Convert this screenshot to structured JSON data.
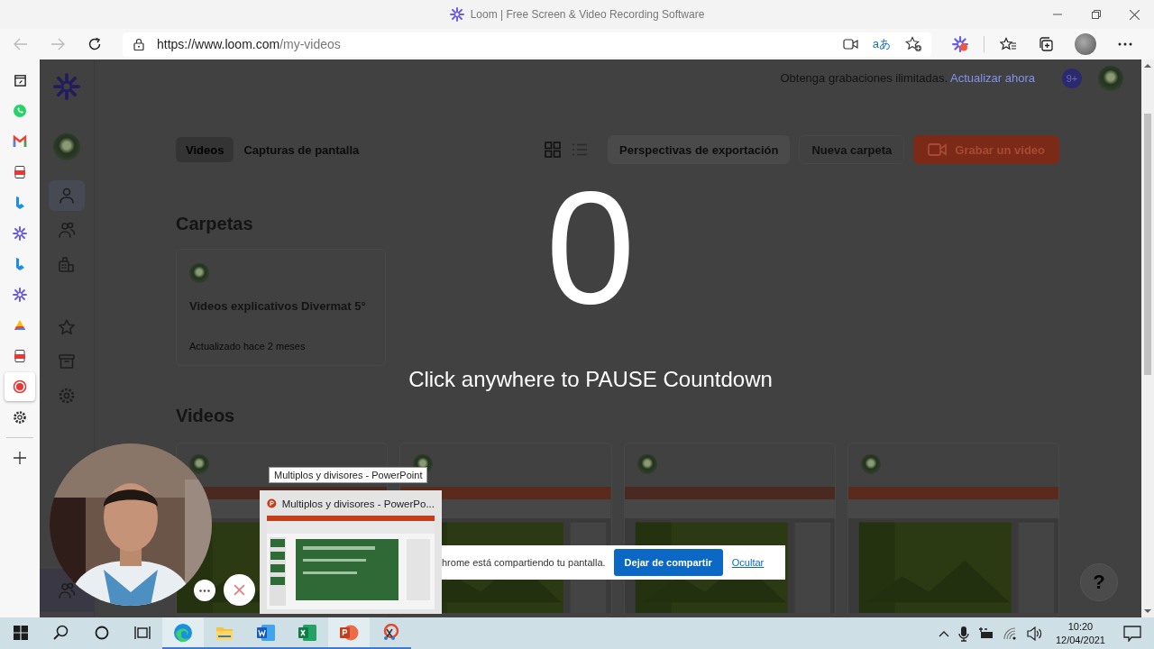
{
  "window": {
    "title": "Loom | Free Screen & Video Recording Software"
  },
  "address_bar": {
    "url_host": "https://www.loom.com",
    "url_path": "/my-videos",
    "translate_glyph": "aあ"
  },
  "edge_sidebar": {
    "items": [
      {
        "selected": false
      },
      {
        "selected": false
      },
      {
        "selected": false
      },
      {
        "selected": false
      },
      {
        "selected": false
      },
      {
        "selected": false
      },
      {
        "selected": false
      },
      {
        "selected": false
      },
      {
        "selected": false
      },
      {
        "selected": false
      },
      {
        "selected": true
      },
      {
        "selected": false
      }
    ]
  },
  "loom_nav": {
    "items": [
      {
        "selected": true
      },
      {
        "selected": false
      },
      {
        "selected": false
      },
      {
        "selected": false
      },
      {
        "selected": false
      },
      {
        "selected": false
      }
    ]
  },
  "header": {
    "promo": "Obtenga grabaciones ilimitadas.",
    "upgrade_link": "Actualizar ahora",
    "notification_badge": "9+"
  },
  "tabs": [
    {
      "label": "Videos",
      "selected": true
    },
    {
      "label": "Capturas de pantalla",
      "selected": false
    }
  ],
  "actions": {
    "export": "Perspectivas de exportación",
    "new_folder": "Nueva carpeta",
    "record": "Grabar un video"
  },
  "folders": {
    "heading": "Carpetas",
    "items": [
      {
        "name": "Videos explicativos Divermat 5°",
        "updated": "Actualizado hace 2 meses"
      }
    ]
  },
  "videos": {
    "heading": "Videos"
  },
  "help_glyph": "?",
  "countdown": {
    "number": "0",
    "hint": "Click anywhere to PAUSE Countdown"
  },
  "taskbar_preview": {
    "tooltip": "Multiplos y divisores - PowerPoint",
    "title": "Multiplos y divisores - PowerPo..."
  },
  "sharing_bar": {
    "message": "hrome está compartiendo tu pantalla.",
    "stop_button": "Dejar de compartir",
    "hide_link": "Ocultar"
  },
  "taskbar": {
    "apps": [
      {
        "running": true,
        "highlighted": true
      },
      {
        "running": true,
        "highlighted": false
      },
      {
        "running": true,
        "highlighted": false
      },
      {
        "running": true,
        "highlighted": false
      },
      {
        "running": true,
        "highlighted": true
      },
      {
        "running": true,
        "highlighted": false
      }
    ],
    "time": "10:20",
    "date": "12/04/2021"
  }
}
